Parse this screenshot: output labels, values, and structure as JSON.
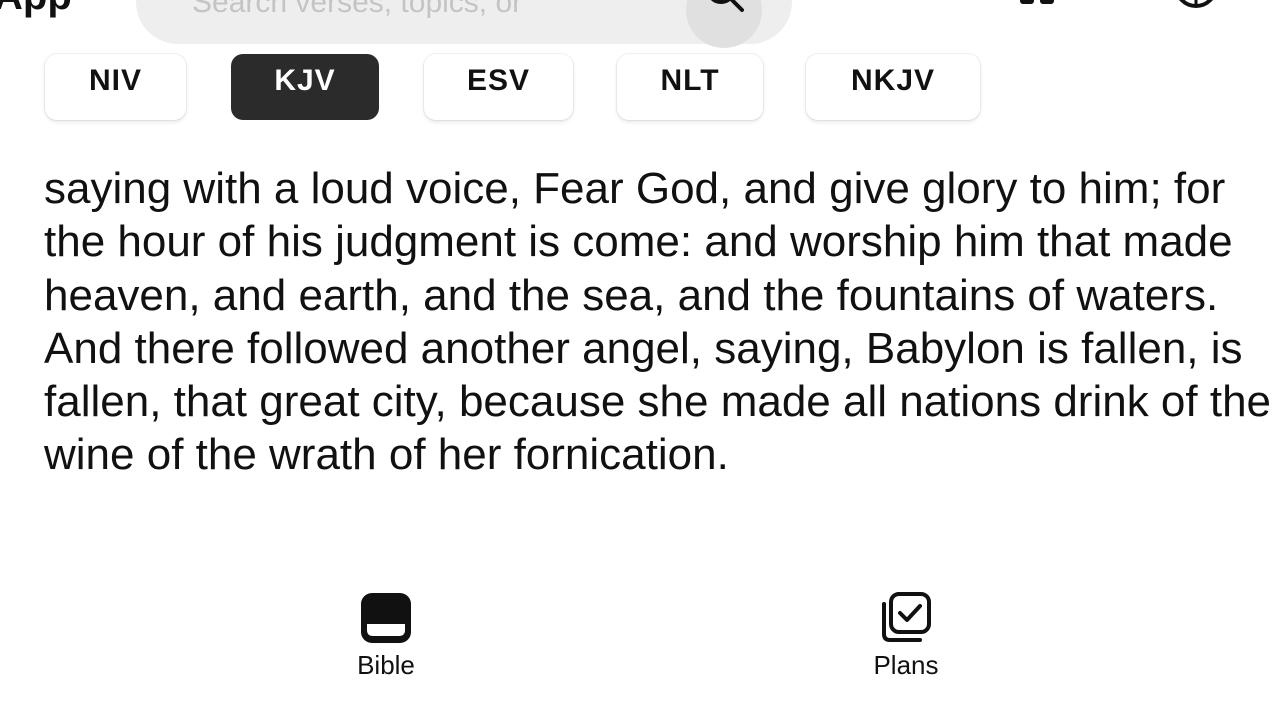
{
  "header": {
    "app_label": "App",
    "search": {
      "placeholder": "Search verses, topics, or"
    }
  },
  "versions": [
    {
      "label": "NIV",
      "active": false
    },
    {
      "label": "KJV",
      "active": true
    },
    {
      "label": "ESV",
      "active": false
    },
    {
      "label": "NLT",
      "active": false
    },
    {
      "label": "NKJV",
      "active": false
    }
  ],
  "verse": {
    "text": "saying with a loud voice, Fear God, and give glory to him; for the hour of his judgment is come: and worship him that made heaven, and earth, and the sea, and the fountains of waters. And there followed another angel, saying, Babylon is fallen, is fallen, that great city, because she made all nations drink of the wine of the wrath of her fornication."
  },
  "bottom_nav": {
    "items": [
      {
        "label": "Bible",
        "icon": "bible-book-icon"
      },
      {
        "label": "Plans",
        "icon": "plans-checklist-icon"
      }
    ]
  },
  "colors": {
    "active_chip": "#2b2b2b",
    "search_bg": "#eeeeee",
    "text": "#111111"
  }
}
